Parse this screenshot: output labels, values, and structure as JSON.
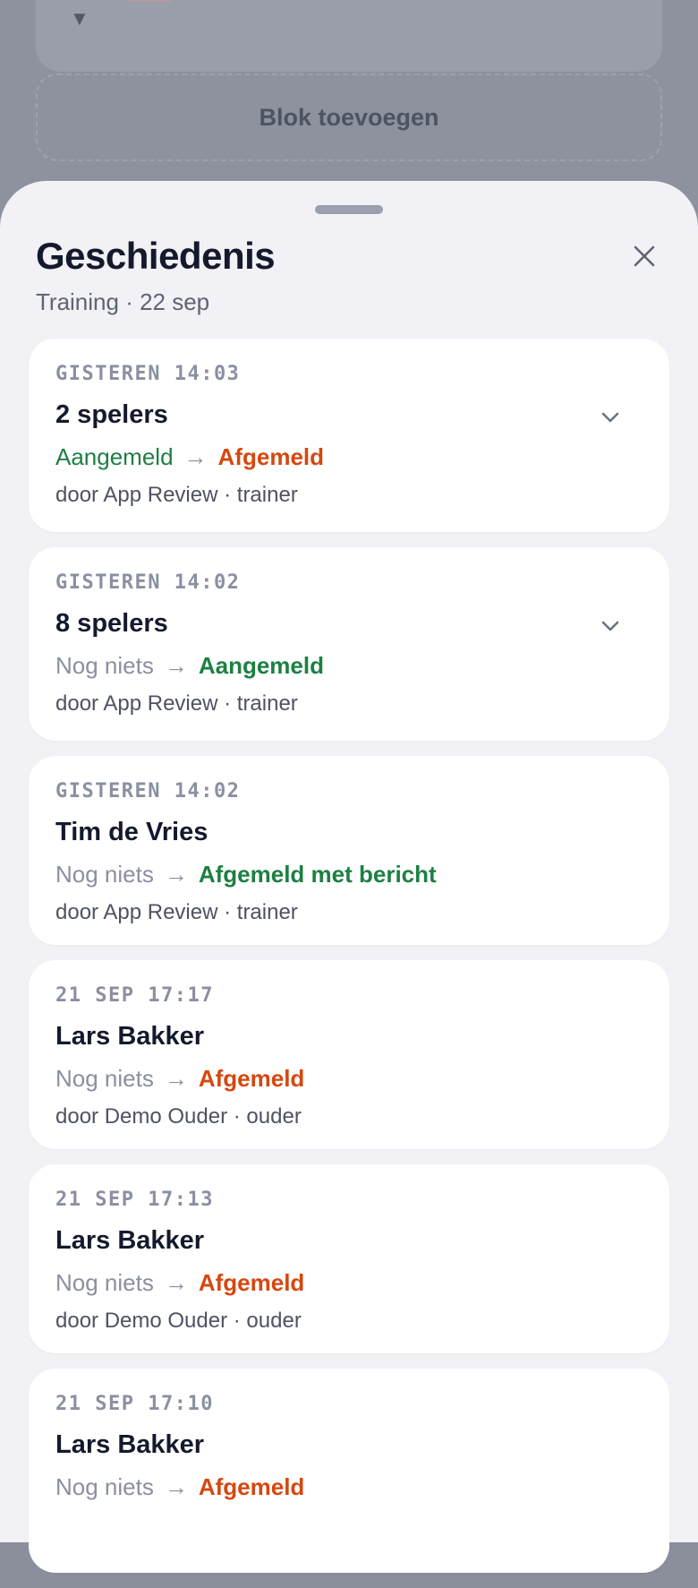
{
  "background": {
    "add_block_label": "Blok toevoegen",
    "caret_icon": "▼"
  },
  "sheet": {
    "title": "Geschiedenis",
    "subtitle": "Training · 22 sep",
    "close_icon": "close-icon",
    "arrow_glyph": "→"
  },
  "entries": [
    {
      "time": "GISTEREN 14:03",
      "who": "2 spelers",
      "from": "Aangemeld",
      "to": "Afgemeld",
      "by": "door App Review · trainer",
      "expandable": true
    },
    {
      "time": "GISTEREN 14:02",
      "who": "8 spelers",
      "from": "Nog niets",
      "to": "Aangemeld",
      "by": "door App Review · trainer",
      "expandable": true
    },
    {
      "time": "GISTEREN 14:02",
      "who": "Tim de Vries",
      "from": "Nog niets",
      "to": "Afgemeld met bericht",
      "by": "door App Review · trainer",
      "expandable": false
    },
    {
      "time": "21 SEP 17:17",
      "who": "Lars Bakker",
      "from": "Nog niets",
      "to": "Afgemeld",
      "by": "door Demo Ouder · ouder",
      "expandable": false
    },
    {
      "time": "21 SEP 17:13",
      "who": "Lars Bakker",
      "from": "Nog niets",
      "to": "Afgemeld",
      "by": "door Demo Ouder · ouder",
      "expandable": false
    },
    {
      "time": "21 SEP 17:10",
      "who": "Lars Bakker",
      "from": "Nog niets",
      "to": "Afgemeld",
      "by": "",
      "expandable": false
    }
  ],
  "colors": {
    "green": "#1d7f43",
    "red": "#d5480f",
    "muted": "#8a90a0",
    "title": "#141a2c"
  }
}
